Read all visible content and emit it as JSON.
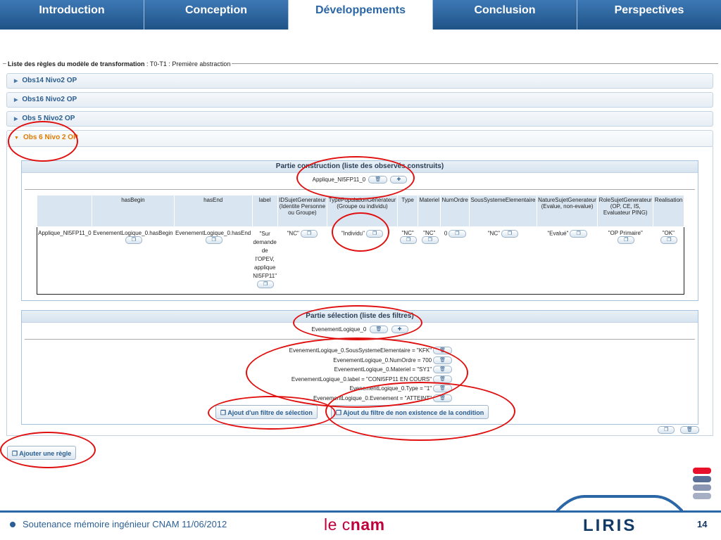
{
  "nav": {
    "tabs": [
      "Introduction",
      "Conception",
      "Développements",
      "Conclusion",
      "Perspectives"
    ],
    "active_index": 2
  },
  "fieldset": {
    "legend_bold": "Liste des règles du modèle de transformation",
    "legend_rest": " : T0-T1 : Première abstraction"
  },
  "accordion": [
    "Obs14 Nivo2 OP",
    "Obs16 Nivo2 OP",
    "Obs 5 Nivo2 OP",
    "Obs 6 Nivo 2 OP"
  ],
  "construction": {
    "title": "Partie construction (liste des observés construits)",
    "selected": "Applique_NI5FP11_0",
    "table": {
      "headers": [
        "",
        "hasBegin",
        "hasEnd",
        "label",
        "IDSujetGenerateur (Identite Personne ou Groupe)",
        "TypePopulationGenerateur (Groupe ou individu)",
        "Type",
        "Materiel",
        "NumOrdre",
        "SousSystemeElementaire",
        "NatureSujetGenerateur (Evalue, non-evalue)",
        "RoleSujetGenerateur (OP, CE, IS, Evaluateur PING)",
        "Realisation"
      ],
      "row": [
        "Applique_NI5FP11_0",
        "EvenementLogique_0.hasBegin",
        "EvenementLogique_0.hasEnd",
        "\"Sur demande de l'OPEV, applique NI5FP11\"",
        "\"NC\"",
        "\"Individu\"",
        "\"NC\"",
        "\"NC\"",
        "0",
        "\"NC\"",
        "\"Evalué\"",
        "\"OP Primaire\"",
        "\"OK\""
      ]
    }
  },
  "selection": {
    "title": "Partie sélection (liste des filtres)",
    "selected": "EvenementLogique_0",
    "filters": [
      "EvenementLogique_0.SousSystemeElementaire = \"KFK\"",
      "EvenementLogique_0.NumOrdre = 700",
      "EvenementLogique_0.Materiel = \"SY1\"",
      "EvenementLogique_0.label = \"CONI5FP11 EN COURS\"",
      "EvenementLogique_0.Type = \"1\"",
      "EvenementLogique_0.Evenement = \"ATTEINT\""
    ],
    "add_filter_label": "Ajout d'un filtre de sélection",
    "add_nonexist_label": "Ajout du filtre de non existence de la condition"
  },
  "add_rule_label": "Ajouter une règle",
  "footer": {
    "text": "Soutenance mémoire ingénieur CNAM 11/06/2012",
    "cnam_le": "le c",
    "cnam_bold": "nam",
    "liris": "LIRIS",
    "page": "14"
  },
  "colors": {
    "accent": "#2b66a6",
    "highlight": "#e01010",
    "cnam": "#c0003b",
    "bar_red": "#e8102a",
    "bar_blue": "#5a6f95",
    "bar_grey": "#a7afc5"
  }
}
